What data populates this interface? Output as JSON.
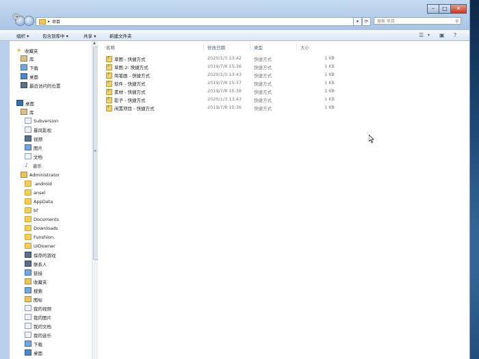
{
  "window": {
    "address_crumb": "项目",
    "search_placeholder": "搜索 项目",
    "overlay_text": "©"
  },
  "toolbar": {
    "organize": "组织 ▾",
    "include_in_library": "包含到库中 ▾",
    "share": "共享 ▾",
    "new_folder": "新建文件夹"
  },
  "sidebar": {
    "favorites": "收藏夹",
    "fav_items": [
      "库",
      "下载",
      "桌面",
      "最近访问的位置"
    ],
    "desktop": "桌面",
    "library": "库",
    "lib_items": [
      "Subversion",
      "暴风影视",
      "视频",
      "图片",
      "文档",
      "音乐"
    ],
    "user": "Administrator",
    "user_items": [
      ".android",
      "ansel",
      "AppData",
      "bf",
      "Documents",
      "Downloads",
      "Funshion",
      "UIDowner",
      "保存的游戏",
      "联系人",
      "链接",
      "收藏夹",
      "搜索",
      "图标",
      "我的视频",
      "我的图片",
      "我的文档",
      "我的音乐",
      "下载",
      "桌面"
    ]
  },
  "columns": {
    "name": "名称",
    "date": "修改日期",
    "type": "类型",
    "size": "大小"
  },
  "files": [
    {
      "name": "草图 - 快捷方式",
      "date": "2020/1/3 13:42",
      "type": "快捷方式",
      "size": "1 KB"
    },
    {
      "name": "草图 2- 快捷方式",
      "date": "2019/7/8 15:36",
      "type": "快捷方式",
      "size": "1 KB"
    },
    {
      "name": "简笔画 - 快捷方式",
      "date": "2020/1/3 13:43",
      "type": "快捷方式",
      "size": "1 KB"
    },
    {
      "name": "软件 - 快捷方式",
      "date": "2019/7/8 15:37",
      "type": "快捷方式",
      "size": "1 KB"
    },
    {
      "name": "素材 - 快捷方式",
      "date": "2019/7/8 15:38",
      "type": "快捷方式",
      "size": "1 KB"
    },
    {
      "name": "影子 - 快捷方式",
      "date": "2020/1/3 13:43",
      "type": "快捷方式",
      "size": "1 KB"
    },
    {
      "name": "闲置项目 - 快捷方式",
      "date": "2019/7/8 15:36",
      "type": "快捷方式",
      "size": "1 KB"
    }
  ]
}
